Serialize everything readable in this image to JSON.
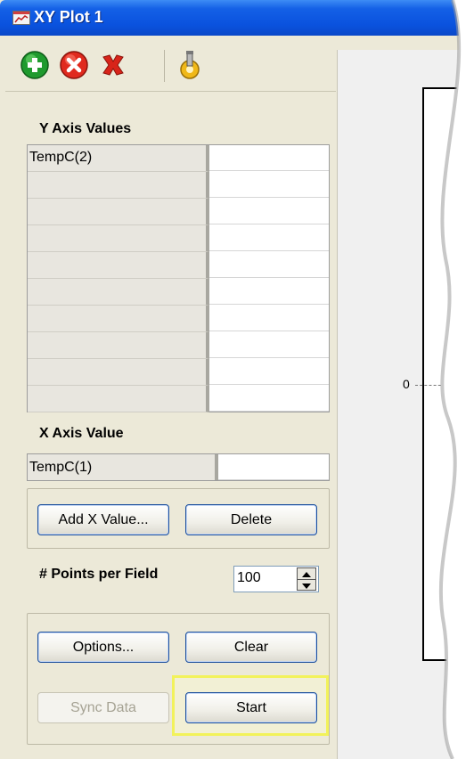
{
  "window": {
    "title": "XY Plot 1"
  },
  "toolbar": {
    "add_icon": "add-green-circle-icon",
    "remove_icon": "remove-red-circle-icon",
    "delete_icon": "delete-red-x-icon",
    "settings_icon": "probe-gear-icon"
  },
  "y_axis": {
    "title": "Y Axis Values",
    "rows": [
      "TempC(2)",
      "",
      "",
      "",
      "",
      "",
      "",
      "",
      "",
      ""
    ]
  },
  "x_axis": {
    "title": "X Axis Value",
    "value": "TempC(1)"
  },
  "buttons": {
    "add_x": "Add X Value...",
    "delete": "Delete",
    "options": "Options...",
    "clear": "Clear",
    "sync": "Sync Data",
    "start": "Start"
  },
  "points": {
    "label": "# Points per Field",
    "value": "100"
  },
  "plot": {
    "y_tick": "0"
  },
  "colors": {
    "title_bar": "#0a52de",
    "highlight": "#f2f25a"
  }
}
